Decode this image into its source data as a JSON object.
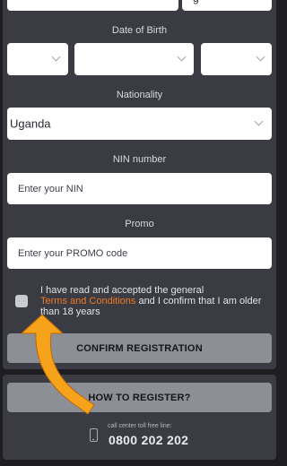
{
  "labels": {
    "dob": "Date of Birth",
    "nationality": "Nationality",
    "nin": "NIN number",
    "promo": "Promo"
  },
  "top_field_partial": "g",
  "nationality_value": "Uganda",
  "nin_placeholder": "Enter your NIN",
  "promo_placeholder": "Enter your PROMO code",
  "terms": {
    "line1": "I have read and accepted the general",
    "link": "Terms and Conditions",
    "after_link": " and I confirm that I am older",
    "line3": "than 18 years"
  },
  "buttons": {
    "confirm": "CONFIRM REGISTRATION",
    "how_to": "HOW TO REGISTER?"
  },
  "call_center": {
    "label": "call center toll free line:",
    "number": "0800 202 202"
  },
  "colors": {
    "accent": "#f07a23",
    "arrow": "#f7a21b"
  },
  "icons": [
    "chevron-down-icon",
    "phone-icon",
    "pointer-arrow-icon"
  ]
}
